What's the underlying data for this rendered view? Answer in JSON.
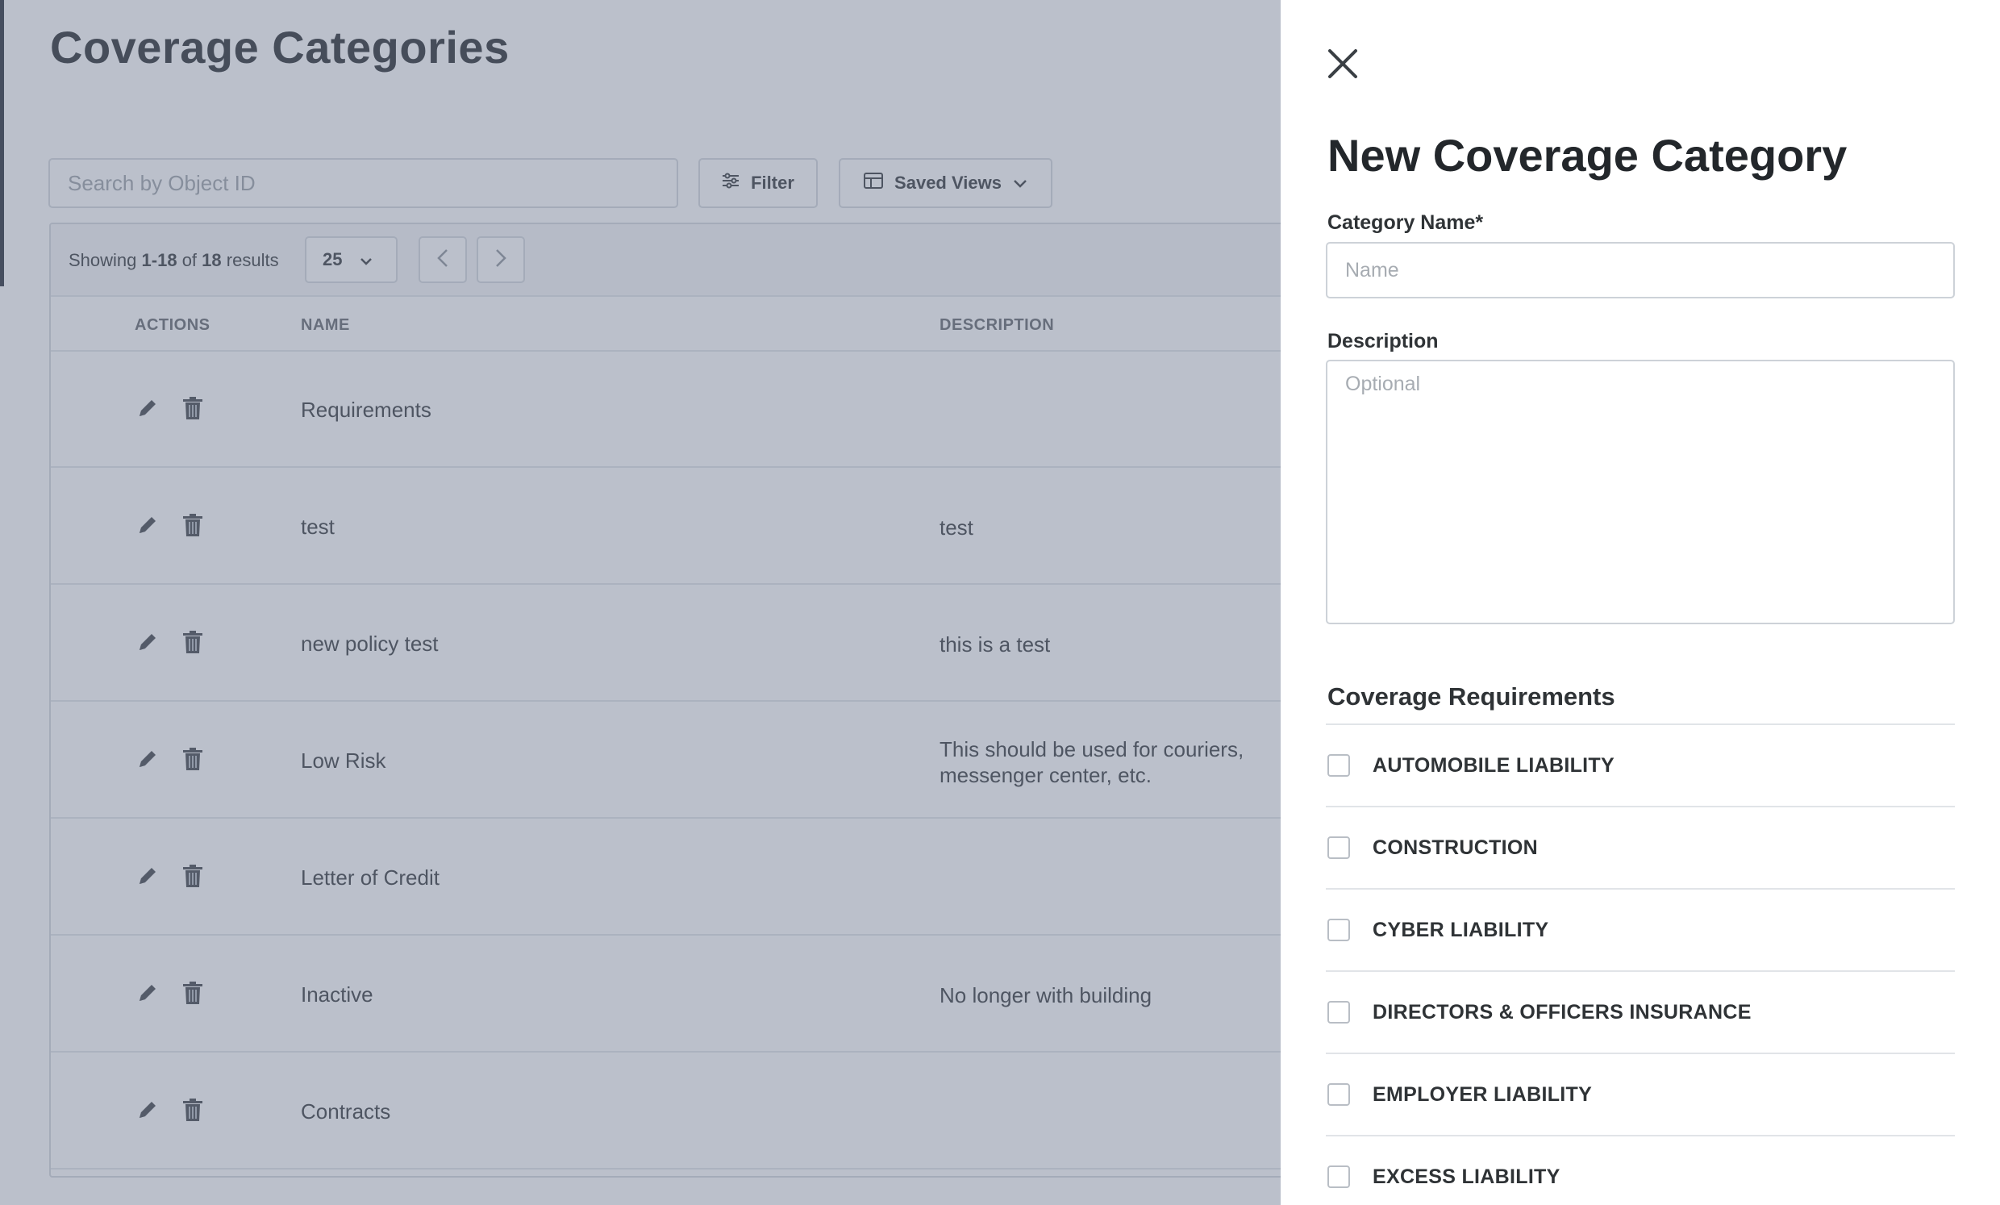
{
  "page": {
    "title": "Coverage Categories",
    "search_placeholder": "Search by Object ID",
    "filter_label": "Filter",
    "saved_views_label": "Saved Views"
  },
  "pagination": {
    "prefix": "Showing",
    "range": "1-18",
    "of": "of",
    "total": "18",
    "suffix": "results",
    "page_size": "25"
  },
  "table": {
    "columns": {
      "actions": "ACTIONS",
      "name": "NAME",
      "description": "DESCRIPTION"
    },
    "rows": [
      {
        "name": "Requirements",
        "description": ""
      },
      {
        "name": "test",
        "description": "test"
      },
      {
        "name": "new policy test",
        "description": "this is a test"
      },
      {
        "name": "Low Risk",
        "description": "This should be used for couriers, messenger center, etc."
      },
      {
        "name": "Letter of Credit",
        "description": ""
      },
      {
        "name": "Inactive",
        "description": "No longer with building"
      },
      {
        "name": "Contracts",
        "description": ""
      }
    ]
  },
  "drawer": {
    "title": "New Coverage Category",
    "name_label": "Category Name*",
    "name_placeholder": "Name",
    "description_label": "Description",
    "description_placeholder": "Optional",
    "coverage_title": "Coverage Requirements",
    "coverage_items": [
      {
        "label": "AUTOMOBILE LIABILITY",
        "checked": false
      },
      {
        "label": "CONSTRUCTION",
        "checked": false
      },
      {
        "label": "CYBER LIABILITY",
        "checked": false
      },
      {
        "label": "DIRECTORS & OFFICERS INSURANCE",
        "checked": false
      },
      {
        "label": "EMPLOYER LIABILITY",
        "checked": false
      },
      {
        "label": "EXCESS LIABILITY",
        "checked": false
      }
    ]
  },
  "colors": {
    "overlay": "#707c92",
    "text": "#2f3336",
    "border": "#d3d7dc"
  },
  "icons": [
    "filter-icon",
    "table-icon",
    "chevron-down-icon",
    "chevron-left-icon",
    "chevron-right-icon",
    "pencil-icon",
    "trash-icon",
    "close-icon"
  ]
}
